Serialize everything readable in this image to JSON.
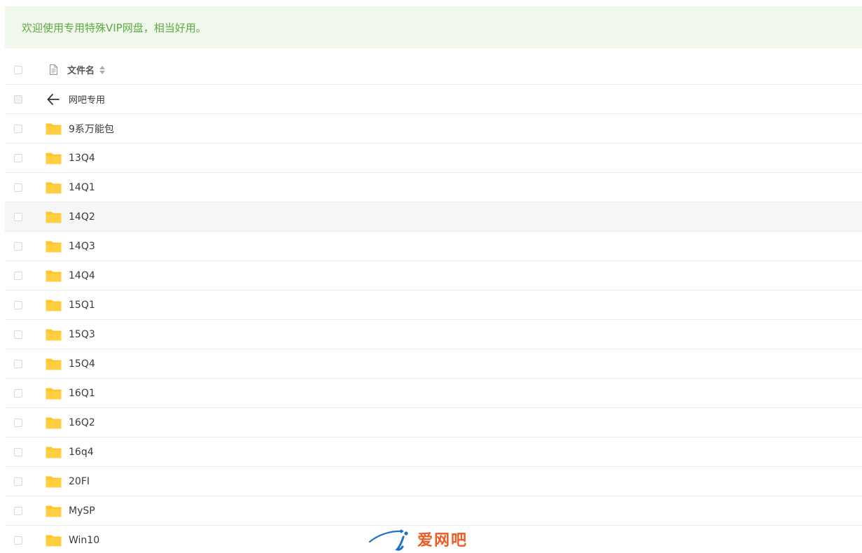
{
  "banner": {
    "text": "欢迎使用专用特殊VIP网盘，相当好用。"
  },
  "header": {
    "column_label": "文件名",
    "icon": "file-icon",
    "sort_icon": "sort-icon"
  },
  "back": {
    "label": "网吧专用",
    "icon": "arrow-left-icon"
  },
  "folders": [
    {
      "name": "9系万能包"
    },
    {
      "name": "13Q4"
    },
    {
      "name": "14Q1"
    },
    {
      "name": "14Q2"
    },
    {
      "name": "14Q3"
    },
    {
      "name": "14Q4"
    },
    {
      "name": "15Q1"
    },
    {
      "name": "15Q3"
    },
    {
      "name": "15Q4"
    },
    {
      "name": "16Q1"
    },
    {
      "name": "16Q2"
    },
    {
      "name": "16q4"
    },
    {
      "name": "20FI"
    },
    {
      "name": "MySP"
    },
    {
      "name": "Win10"
    }
  ],
  "watermark": {
    "text": "爱网吧"
  },
  "colors": {
    "banner_bg": "#eff8ea",
    "banner_text": "#62a846",
    "folder": "#ffc527",
    "row_hover": "#f5f6f8",
    "watermark_orange": "#ee5a24",
    "watermark_blue": "#1a73c8"
  }
}
